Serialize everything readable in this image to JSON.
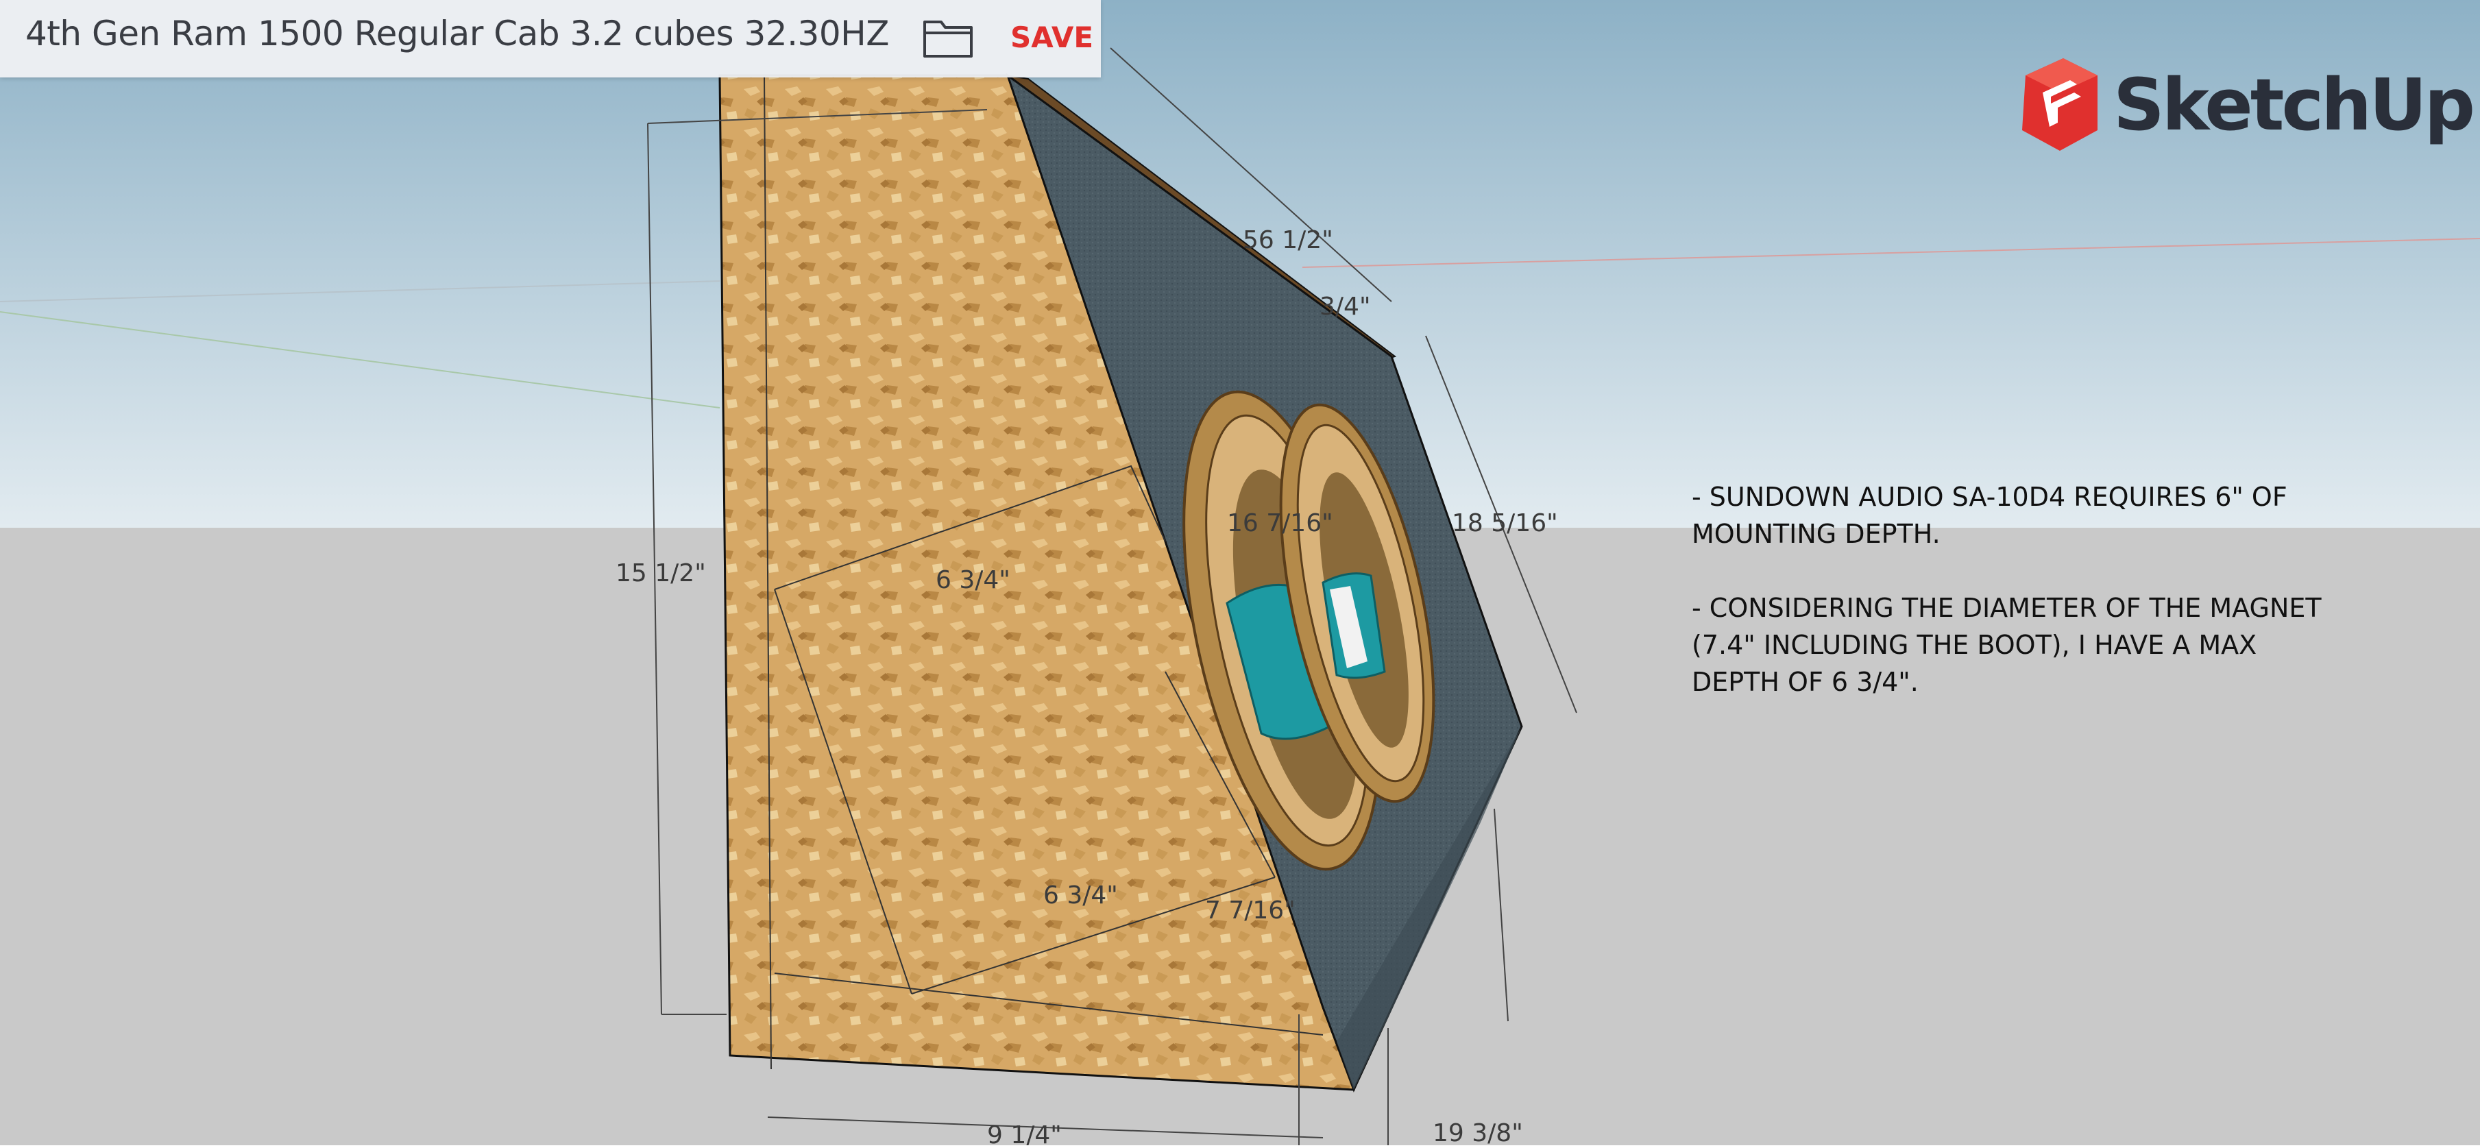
{
  "header": {
    "title": "4th Gen Ram 1500 Regular Cab 3.2 cubes 32.30HZ",
    "open_icon": "folder-icon",
    "save_label": "SAVE",
    "save_color": "#e0302e"
  },
  "logo": {
    "text": "SketchUp",
    "icon": "sketchup-logo-icon",
    "brand_color": "#e0302e"
  },
  "dimensions": {
    "top_length": "56 1/2\"",
    "top_thickness": "3/4\"",
    "baffle_height": "18 5/16\"",
    "baffle_inner": "16 7/16\"",
    "left_height": "15 1/2\"",
    "inner_depth_upper": "6 3/4\"",
    "inner_depth_lower": "6 3/4\"",
    "bottom_offset": "7 7/16\"",
    "bottom_width": "9 1/4\"",
    "bottom_depth": "19 3/8\""
  },
  "notes": [
    "- SUNDOWN AUDIO SA-10D4 REQUIRES 6\" OF MOUNTING DEPTH.",
    "- CONSIDERING THE DIAMETER OF THE MAGNET (7.4\" INCLUDING THE BOOT), I HAVE A MAX DEPTH OF 6 3/4\"."
  ],
  "colors": {
    "sky_top": "#8eb3c8",
    "sky_bottom": "#dde8ee",
    "ground": "#c9c9c9",
    "wood": "#d9ae6a",
    "baffle": "#4a5a63",
    "speaker_cone": "#1d9aa2"
  }
}
